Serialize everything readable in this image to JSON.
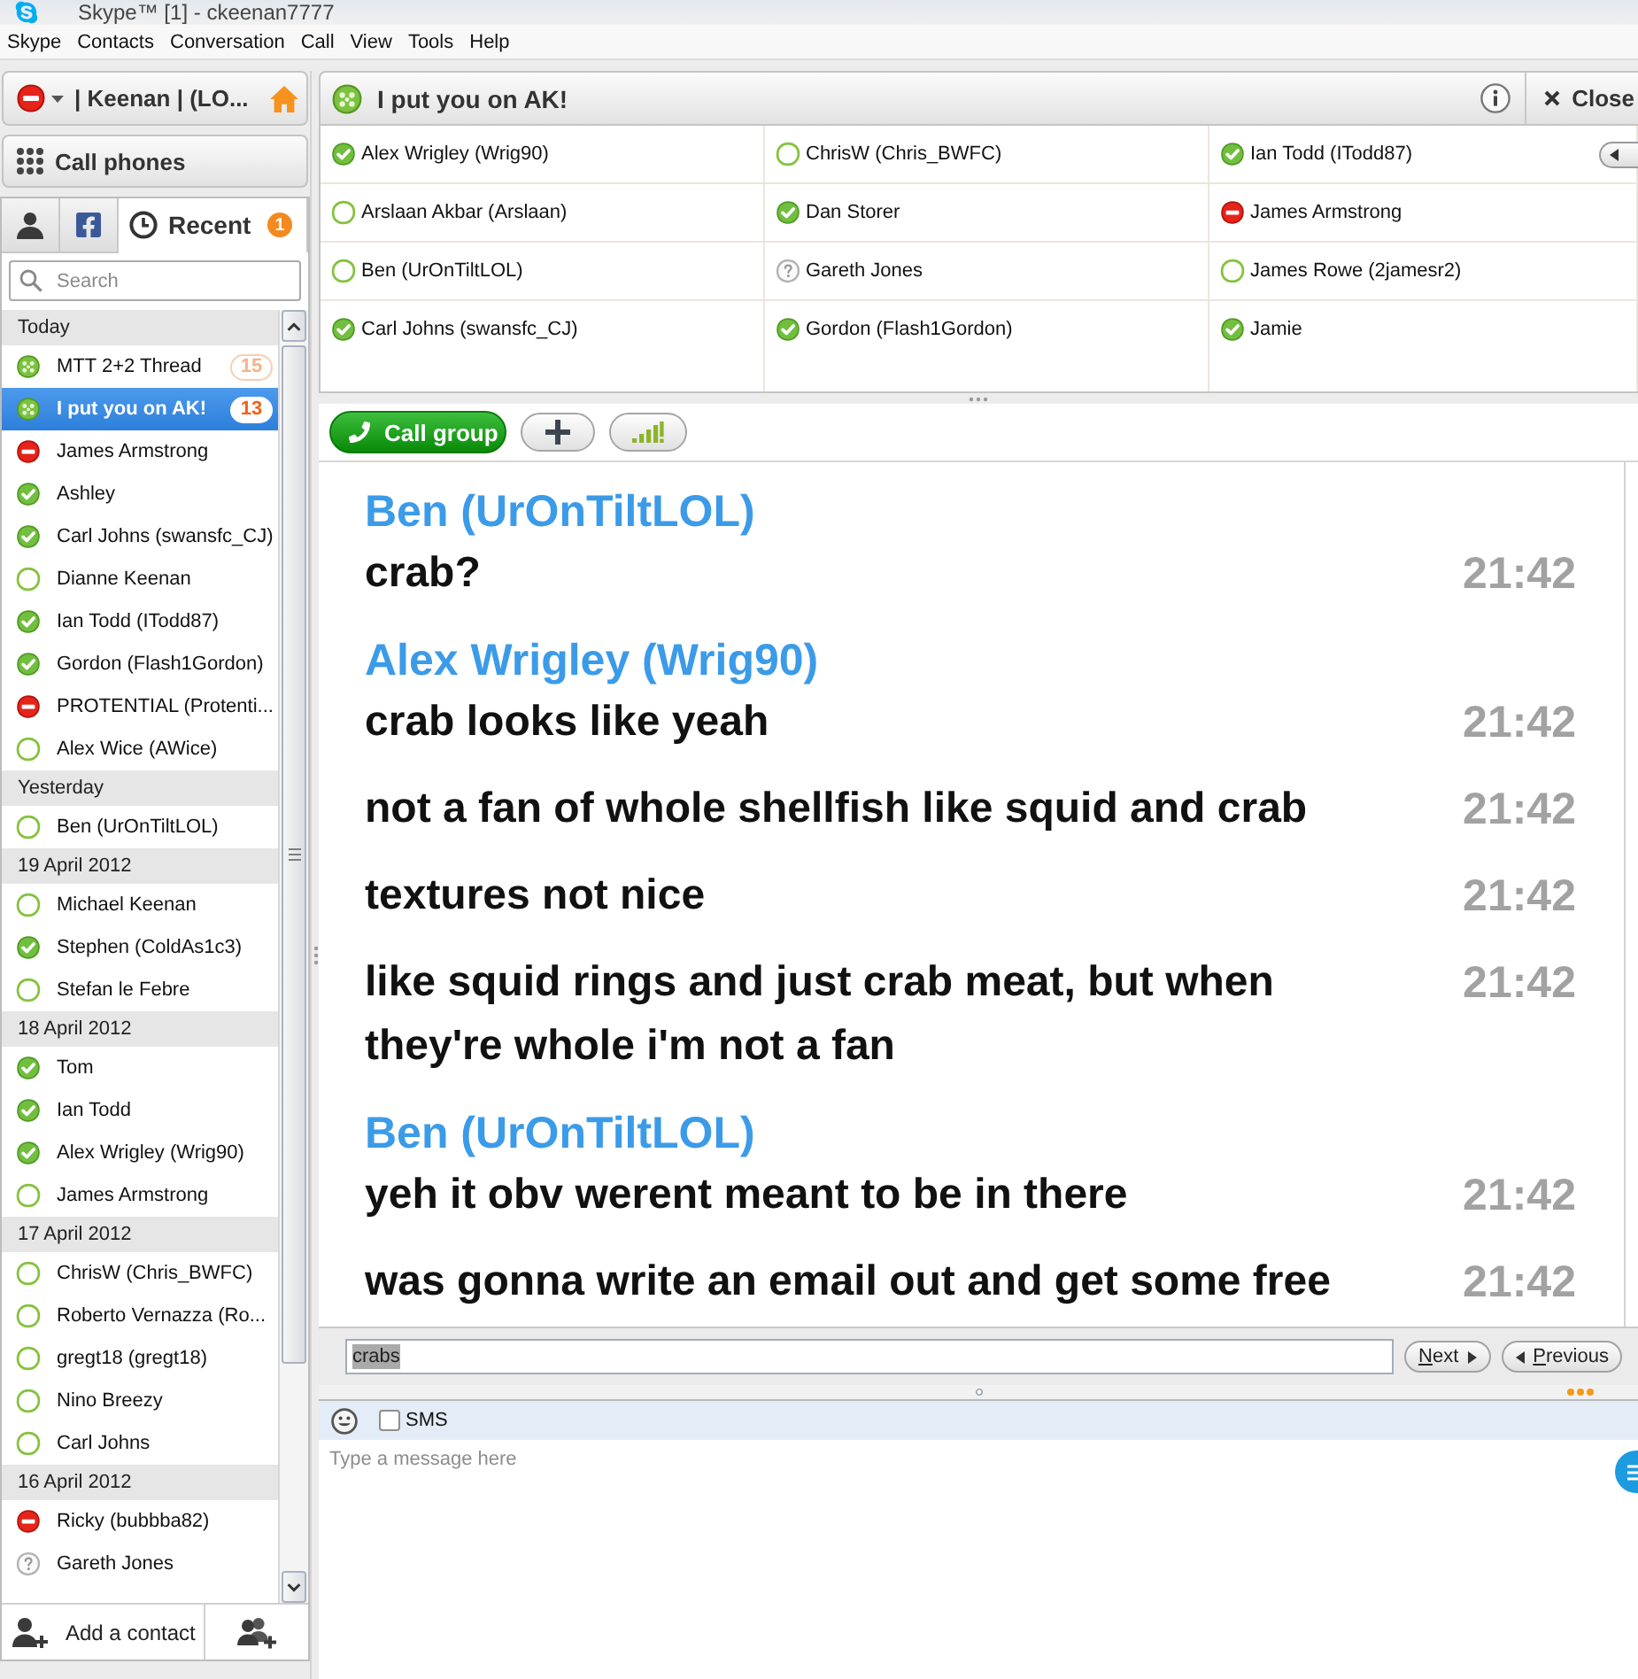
{
  "window": {
    "title": "Skype™ [1] - ckeenan7777"
  },
  "menu": [
    "Skype",
    "Contacts",
    "Conversation",
    "Call",
    "View",
    "Tools",
    "Help"
  ],
  "sidebar": {
    "status_button": {
      "kind": "busy",
      "label": "| Keenan | (LO..."
    },
    "call_phones": {
      "label": "Call phones"
    },
    "tabs": [
      {
        "kind": "contacts",
        "selected": false
      },
      {
        "kind": "facebook",
        "selected": false
      },
      {
        "kind": "recent",
        "label": "Recent",
        "badge": "1",
        "selected": true
      }
    ],
    "search": {
      "placeholder": "Search"
    },
    "groups": [
      {
        "heading": "Today",
        "items": [
          {
            "name": "MTT 2+2 Thread",
            "kind": "group",
            "badge": "15",
            "selected": false
          },
          {
            "name": "I put you on AK!",
            "kind": "group",
            "badge": "13",
            "selected": true
          },
          {
            "name": "James Armstrong",
            "kind": "busy",
            "selected": false
          },
          {
            "name": "Ashley",
            "kind": "online",
            "selected": false
          },
          {
            "name": "Carl Johns (swansfc_CJ)",
            "kind": "online",
            "selected": false
          },
          {
            "name": "Dianne Keenan",
            "kind": "offline",
            "selected": false
          },
          {
            "name": "Ian Todd (ITodd87)",
            "kind": "online",
            "selected": false
          },
          {
            "name": "Gordon (Flash1Gordon)",
            "kind": "online",
            "selected": false
          },
          {
            "name": "PROTENTIAL (Protenti...",
            "kind": "busy",
            "selected": false
          },
          {
            "name": "Alex Wice (AWice)",
            "kind": "offline",
            "selected": false
          }
        ]
      },
      {
        "heading": "Yesterday",
        "items": [
          {
            "name": "Ben (UrOnTiltLOL)",
            "kind": "offline",
            "selected": false
          }
        ]
      },
      {
        "heading": "19 April 2012",
        "items": [
          {
            "name": "Michael Keenan",
            "kind": "offline",
            "selected": false
          },
          {
            "name": "Stephen (ColdAs1c3)",
            "kind": "online",
            "selected": false
          },
          {
            "name": "Stefan le Febre",
            "kind": "offline",
            "selected": false
          }
        ]
      },
      {
        "heading": "18 April 2012",
        "items": [
          {
            "name": "Tom",
            "kind": "online",
            "selected": false
          },
          {
            "name": "Ian Todd",
            "kind": "online",
            "selected": false
          },
          {
            "name": "Alex Wrigley (Wrig90)",
            "kind": "online",
            "selected": false
          },
          {
            "name": "James Armstrong",
            "kind": "offline",
            "selected": false
          }
        ]
      },
      {
        "heading": "17 April 2012",
        "items": [
          {
            "name": "ChrisW (Chris_BWFC)",
            "kind": "offline",
            "selected": false
          },
          {
            "name": "Roberto Vernazza (Ro...",
            "kind": "offline",
            "selected": false
          },
          {
            "name": "gregt18 (gregt18)",
            "kind": "offline",
            "selected": false
          },
          {
            "name": "Nino Breezy",
            "kind": "offline",
            "selected": false
          },
          {
            "name": "Carl Johns",
            "kind": "offline",
            "selected": false
          }
        ]
      },
      {
        "heading": "16 April 2012",
        "items": [
          {
            "name": "Ricky (bubbba82)",
            "kind": "busy",
            "selected": false
          },
          {
            "name": "Gareth Jones",
            "kind": "unknown",
            "selected": false
          }
        ]
      }
    ],
    "add_contact": {
      "label": "Add a contact"
    }
  },
  "conversation": {
    "title": "I put you on AK!",
    "close": "Close",
    "participants": [
      {
        "name": "Alex Wrigley (Wrig90)",
        "kind": "online"
      },
      {
        "name": "Arslaan Akbar (Arslaan)",
        "kind": "offline"
      },
      {
        "name": "Ben (UrOnTiltLOL)",
        "kind": "offline"
      },
      {
        "name": "Carl Johns (swansfc_CJ)",
        "kind": "online"
      },
      {
        "name": "ChrisW (Chris_BWFC)",
        "kind": "offline"
      },
      {
        "name": "Dan Storer",
        "kind": "online"
      },
      {
        "name": "Gareth Jones",
        "kind": "unknown"
      },
      {
        "name": "Gordon (Flash1Gordon)",
        "kind": "online"
      },
      {
        "name": "Ian Todd (ITodd87)",
        "kind": "online"
      },
      {
        "name": "James Armstrong",
        "kind": "busy"
      },
      {
        "name": "James Rowe (2jamesr2)",
        "kind": "offline"
      },
      {
        "name": "Jamie",
        "kind": "online"
      }
    ],
    "call_group": "Call group",
    "messages": [
      {
        "sender": "Ben (UrOnTiltLOL)",
        "lines": [
          {
            "text": "crab?",
            "time": "21:42"
          }
        ]
      },
      {
        "sender": "Alex Wrigley (Wrig90)",
        "lines": [
          {
            "text": "crab looks like yeah",
            "time": "21:42"
          },
          {
            "text": "not a fan of whole shellfish like squid and crab",
            "time": "21:42"
          },
          {
            "text": "textures not nice",
            "time": "21:42"
          },
          {
            "text": "like squid rings and just crab meat, but when they're whole i'm not a fan",
            "time": "21:42"
          }
        ]
      },
      {
        "sender": "Ben (UrOnTiltLOL)",
        "lines": [
          {
            "text": "yeh it obv werent meant to be in there",
            "time": "21:42"
          },
          {
            "text": "was gonna write an email out and get some free",
            "time": "21:42"
          }
        ]
      }
    ],
    "find": {
      "value": "crabs",
      "highlighted": true,
      "next": "Next",
      "previous": "Previous"
    },
    "compose": {
      "sms_label": "SMS",
      "sms_checked": false,
      "placeholder": "Type a message here"
    }
  }
}
